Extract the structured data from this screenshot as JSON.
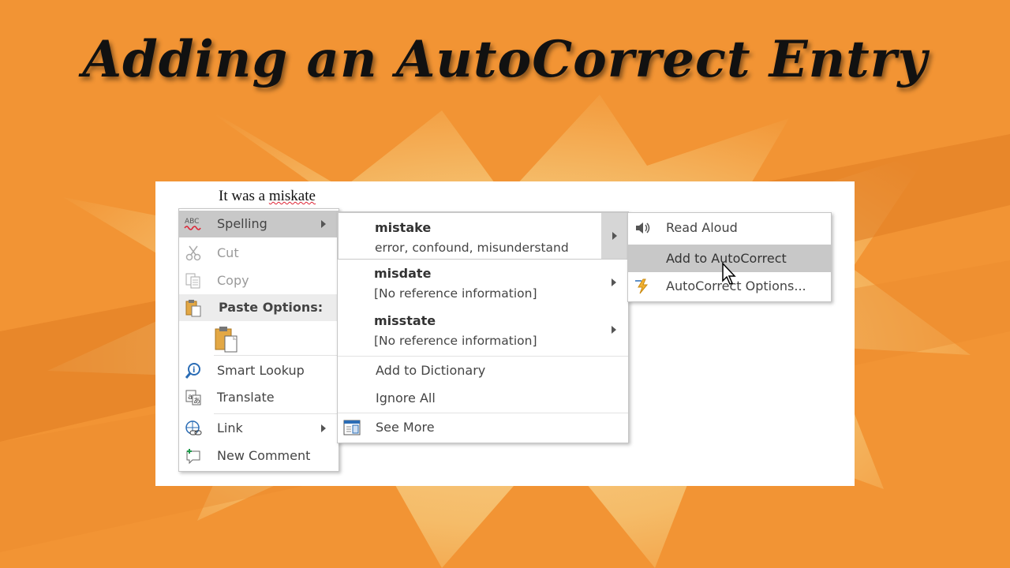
{
  "slide": {
    "title": "Adding an AutoCorrect Entry"
  },
  "document": {
    "text_prefix": "It was a ",
    "misspelled_word": "miskate"
  },
  "context_menu": {
    "spelling": {
      "label": "Spelling",
      "icon": "abc-spelling-icon"
    },
    "cut": {
      "label": "Cut",
      "icon": "scissors-icon"
    },
    "copy": {
      "label": "Copy",
      "icon": "copy-icon"
    },
    "paste_options": {
      "label": "Paste Options:",
      "icon": "clipboard-icon"
    },
    "smart_lookup": {
      "label": "Smart Lookup",
      "icon": "smart-lookup-icon"
    },
    "translate": {
      "label": "Translate",
      "icon": "translate-icon"
    },
    "link": {
      "label": "Link",
      "icon": "link-icon"
    },
    "new_comment": {
      "label": "New Comment",
      "icon": "comment-icon"
    }
  },
  "spelling_submenu": {
    "suggestions": [
      {
        "word": "mistake",
        "synonyms": "error, confound, misunderstand"
      },
      {
        "word": "misdate",
        "synonyms": "[No reference information]"
      },
      {
        "word": "misstate",
        "synonyms": "[No reference information]"
      }
    ],
    "add_to_dictionary": "Add to Dictionary",
    "ignore_all": "Ignore All",
    "see_more": "See More"
  },
  "suggestion_submenu": {
    "read_aloud": "Read Aloud",
    "add_to_autocorrect": "Add to AutoCorrect",
    "autocorrect_options": "AutoCorrect Options..."
  },
  "colors": {
    "background": "#f29434",
    "highlight": "#c8c8c8",
    "hover_gray": "#dadada"
  }
}
